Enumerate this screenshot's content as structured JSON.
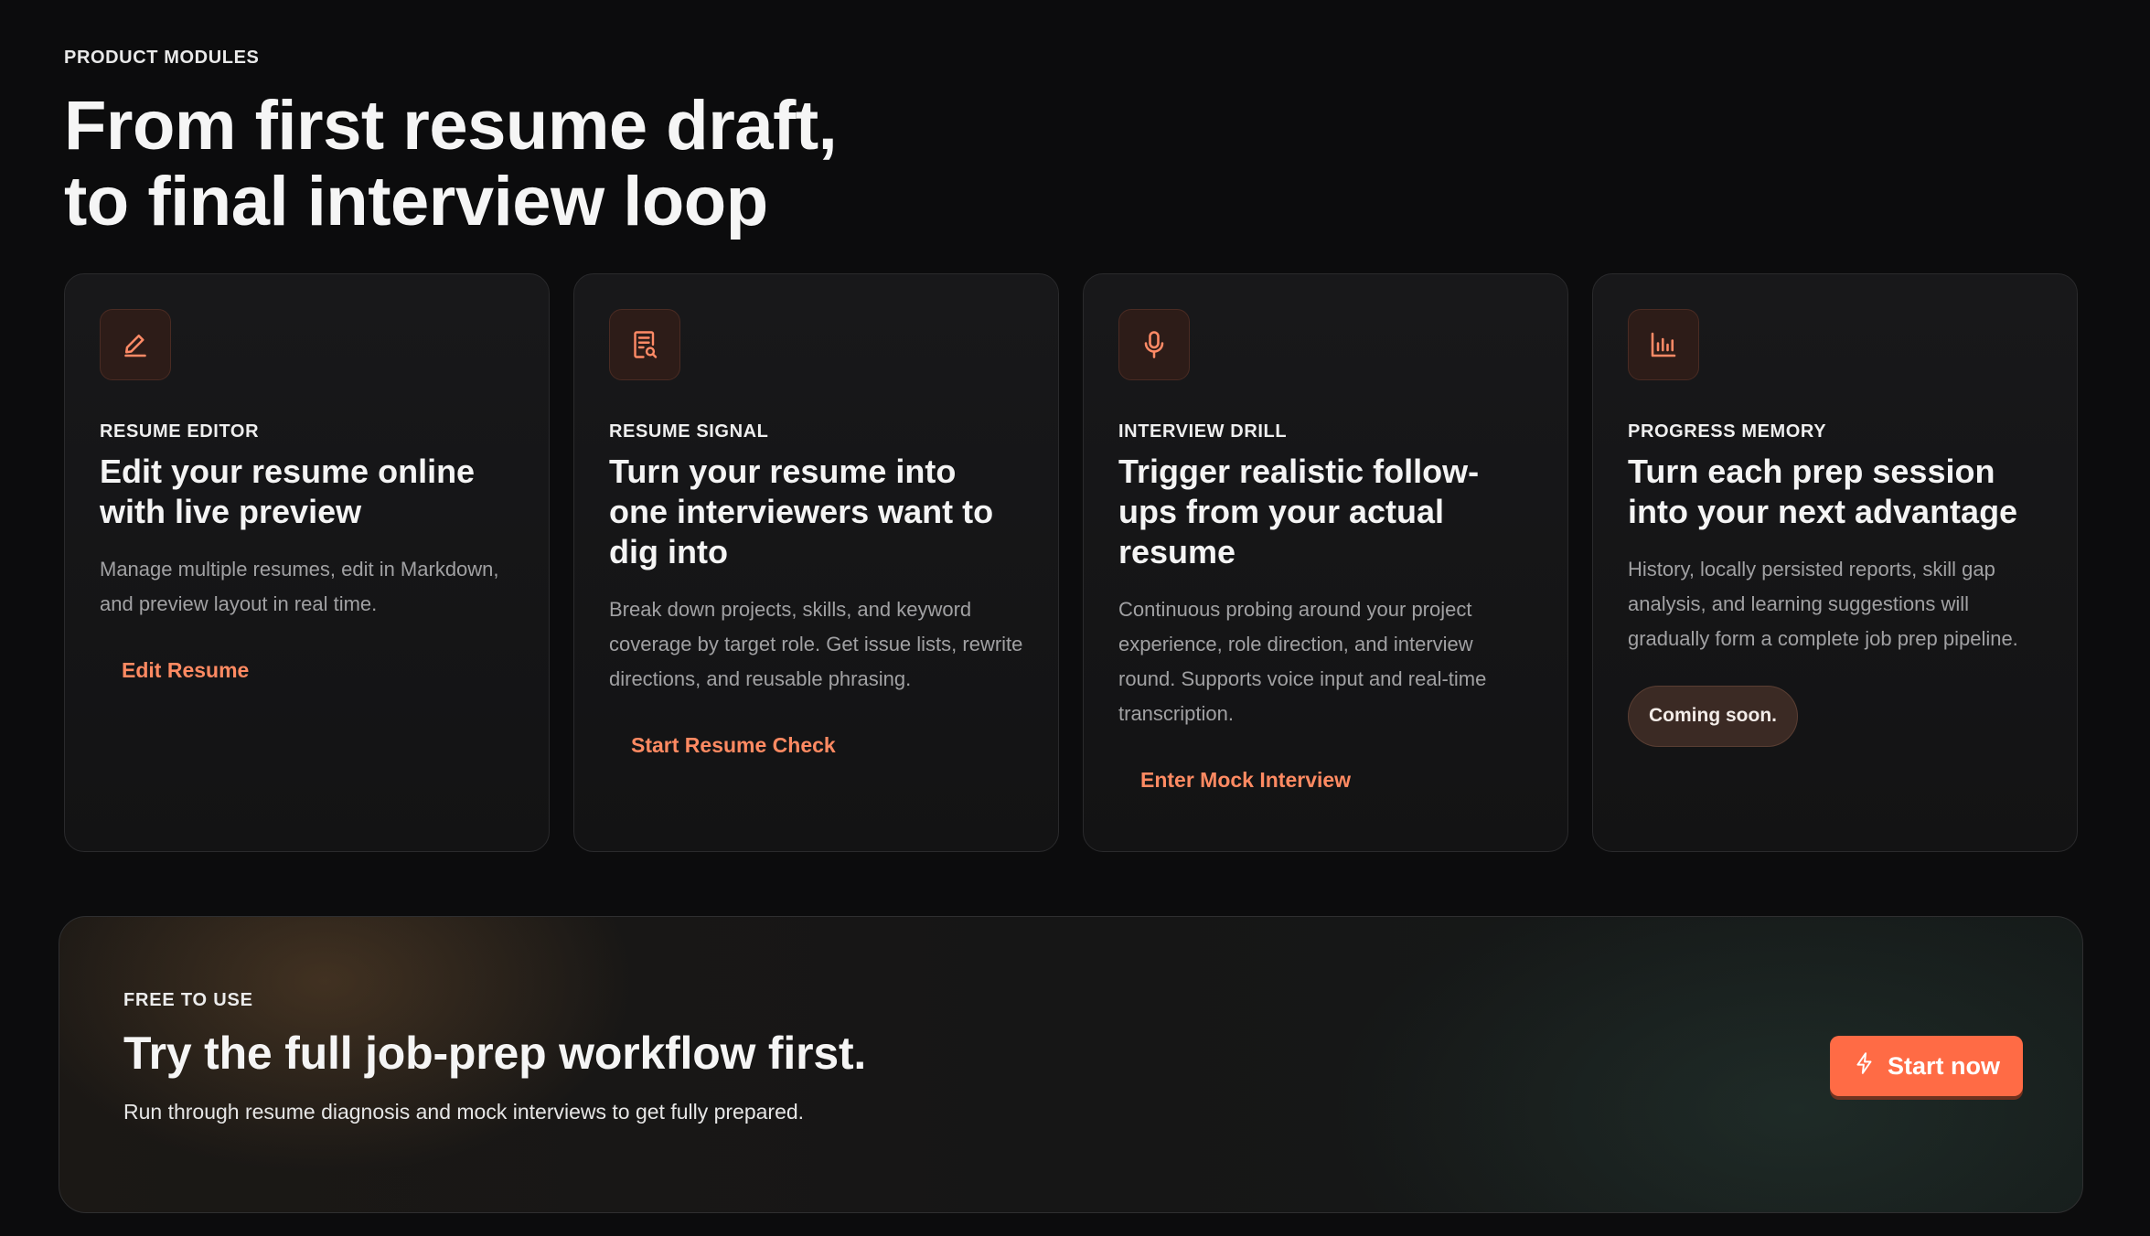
{
  "section": {
    "eyebrow": "PRODUCT MODULES",
    "headline_line1": "From first resume draft,",
    "headline_line2": "to final interview loop"
  },
  "cards": [
    {
      "icon": "pencil-icon",
      "tag": "RESUME EDITOR",
      "title": "Edit your resume online with live preview",
      "description": "Manage multiple resumes, edit in Markdown, and preview layout in real time.",
      "link": "Edit Resume"
    },
    {
      "icon": "document-search-icon",
      "tag": "RESUME SIGNAL",
      "title": "Turn your resume into one interviewers want to dig into",
      "description": "Break down projects, skills, and keyword coverage by target role. Get issue lists, rewrite directions, and reusable phrasing.",
      "link": "Start Resume Check"
    },
    {
      "icon": "microphone-icon",
      "tag": "INTERVIEW DRILL",
      "title": "Trigger realistic follow-ups from your actual resume",
      "description": "Continuous probing around your project experience, role direction, and interview round. Supports voice input and real-time transcription.",
      "link": "Enter Mock Interview"
    },
    {
      "icon": "bar-chart-icon",
      "tag": "PROGRESS MEMORY",
      "title": "Turn each prep session into your next advantage",
      "description": "History, locally persisted reports, skill gap analysis, and learning suggestions will gradually form a complete job prep pipeline.",
      "badge": "Coming soon."
    }
  ],
  "cta": {
    "eyebrow": "FREE TO USE",
    "title": "Try the full job-prep workflow first.",
    "subtitle": "Run through resume diagnosis and mock interviews to get fully prepared.",
    "button_label": "Start now",
    "button_icon": "lightning-icon"
  },
  "colors": {
    "accent": "#ff6b45",
    "link": "#ff8a62",
    "background": "#0c0c0d",
    "card": "#18181a"
  }
}
